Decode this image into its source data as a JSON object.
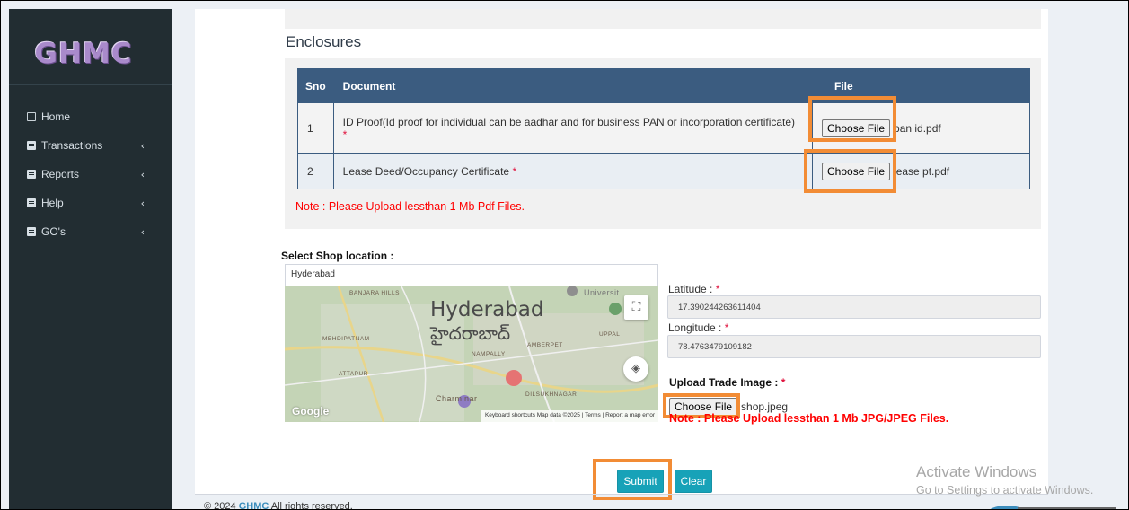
{
  "brand": {
    "logo_text": "GHMC"
  },
  "sidebar": {
    "items": [
      {
        "label": "Home",
        "icon": "square-icon",
        "has_chevron": false
      },
      {
        "label": "Transactions",
        "icon": "book-icon",
        "has_chevron": true
      },
      {
        "label": "Reports",
        "icon": "book-icon",
        "has_chevron": true
      },
      {
        "label": "Help",
        "icon": "book-icon",
        "has_chevron": true
      },
      {
        "label": "GO's",
        "icon": "book-icon",
        "has_chevron": true
      }
    ],
    "chevron": "‹"
  },
  "enclosures": {
    "title": "Enclosures",
    "headers": {
      "sno": "Sno",
      "document": "Document",
      "file": "File"
    },
    "rows": [
      {
        "sno": "1",
        "document": "ID Proof(Id proof for individual can be aadhar and for business PAN or incorporation certificate)",
        "required": "*",
        "button": "Choose File",
        "file_name": "pan id.pdf"
      },
      {
        "sno": "2",
        "document": "Lease Deed/Occupancy Certificate",
        "required": "*",
        "button": "Choose File",
        "file_name": "lease pt.pdf"
      }
    ],
    "note": "Note : Please Upload lessthan 1 Mb Pdf Files."
  },
  "location": {
    "label": "Select Shop location :",
    "search_value": "Hyderabad",
    "map": {
      "city_en": "Hyderabad",
      "city_te": "హైదరాబాద్",
      "places": [
        "BANJARA HILLS",
        "MEHDIPATNAM",
        "AMBERPET",
        "NAMPALLY",
        "ATTAPUR",
        "DILSUKHNAGAR",
        "Charminar",
        "Universit",
        "UPPAL"
      ],
      "provider": "Google",
      "attribution": "Keyboard shortcuts   Map data ©2025  |  Terms  |  Report a map error",
      "fullscreen_glyph": "⛶",
      "nav_glyph": "◈"
    }
  },
  "coordinates": {
    "latitude_label": "Latitude :",
    "latitude_value": "17.390244263611404",
    "longitude_label": "Longitude :",
    "longitude_value": "78.4763479109182",
    "required": "*"
  },
  "trade_image": {
    "label": "Upload Trade Image :",
    "required": "*",
    "button": "Choose File",
    "file_name": "shop.jpeg",
    "note": "Note : Please Upload lessthan 1 Mb JPG/JPEG Files."
  },
  "actions": {
    "submit": "Submit",
    "clear": "Clear"
  },
  "footer": {
    "copyright_prefix": "© 2024",
    "brand": "GHMC",
    "copyright_suffix": "All rights reserved."
  },
  "watermark": {
    "title": "Activate Windows",
    "subtitle": "Go to Settings to activate Windows."
  },
  "colors": {
    "sidebar_bg": "#222d32",
    "table_header": "#3b5c80",
    "highlight": "#f28c35",
    "button": "#17a2b8",
    "warning_text": "#ff0000"
  }
}
